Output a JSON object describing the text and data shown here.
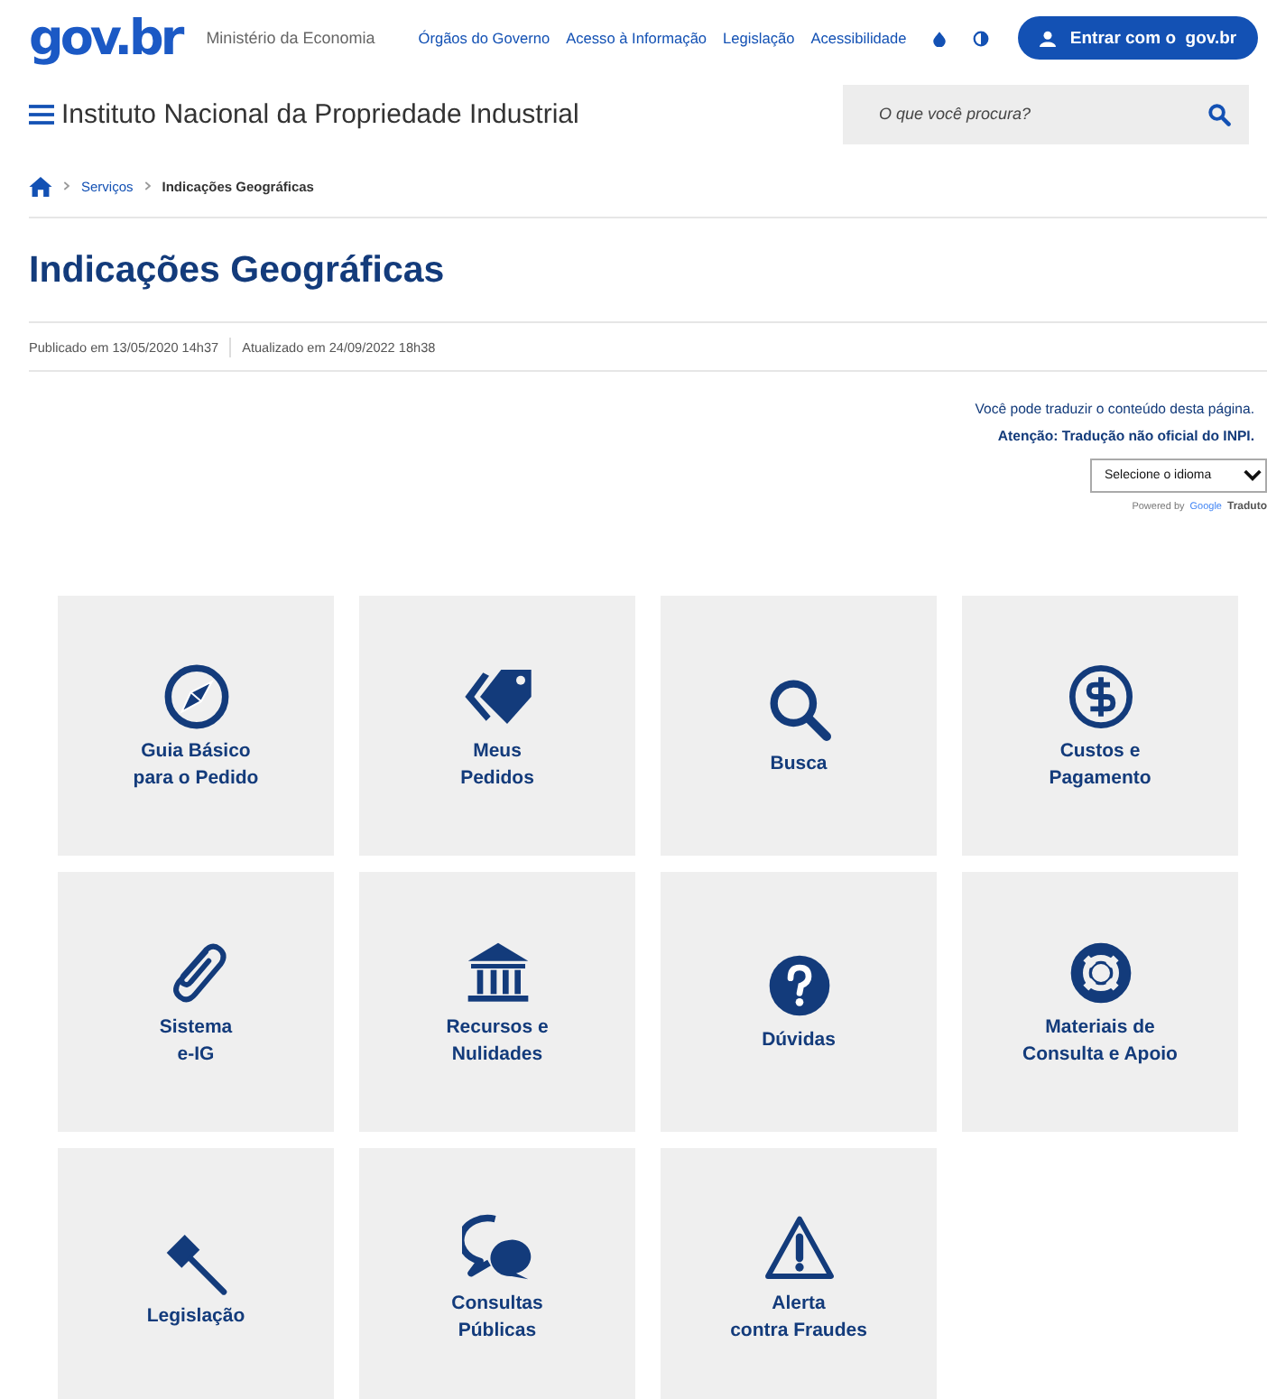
{
  "header": {
    "logo": "gov.br",
    "ministry": "Ministério da Economia",
    "links": [
      "Órgãos do Governo",
      "Acesso à Informação",
      "Legislação",
      "Acessibilidade"
    ],
    "login_button": "Entrar com o  gov.br"
  },
  "site": {
    "title": "Instituto Nacional da Propriedade Industrial",
    "search": {
      "placeholder": "O que você procura?"
    }
  },
  "breadcrumb": [
    {
      "label": "Serviços",
      "current": false
    },
    {
      "label": "Indicações Geográficas",
      "current": true
    }
  ],
  "page": {
    "title": "Indicações Geográficas",
    "published": "Publicado em 13/05/2020 14h37",
    "updated": "Atualizado em 24/09/2022 18h38"
  },
  "translate": {
    "note": "Você pode traduzir o conteúdo desta página.",
    "warning": "Atenção: Tradução não oficial do INPI.",
    "select": "Selecione o idioma",
    "powered_by": "Powered by",
    "google": "Google",
    "service": "Traduto"
  },
  "tiles": [
    {
      "label": "Guia Básico\npara o Pedido"
    },
    {
      "label": "Meus\nPedidos"
    },
    {
      "label": "Busca"
    },
    {
      "label": "Custos e\nPagamento"
    },
    {
      "label": "Sistema\ne-IG"
    },
    {
      "label": "Recursos e\nNulidades"
    },
    {
      "label": "Dúvidas"
    },
    {
      "label": "Materiais de\nConsulta e Apoio"
    },
    {
      "label": "Legislação"
    },
    {
      "label": "Consultas\nPúblicas"
    },
    {
      "label": "Alerta\ncontra Fraudes"
    }
  ]
}
